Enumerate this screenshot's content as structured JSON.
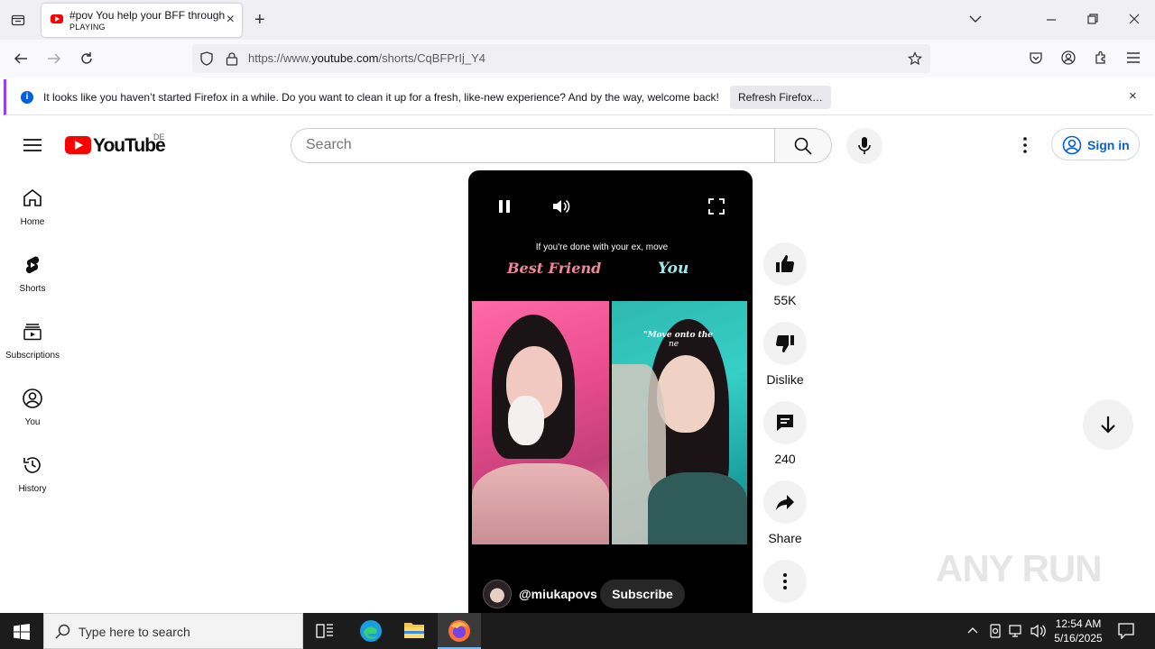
{
  "browser": {
    "tab": {
      "title": "#pov You help your BFF through",
      "status": "PLAYING",
      "close": "×"
    },
    "new_tab": "+",
    "url_prefix": "https://www.",
    "url_domain": "youtube.com",
    "url_path": "/shorts/CqBFPrIj_Y4",
    "notification": {
      "message": "It looks like you haven’t started Firefox in a while. Do you want to clean it up for a fresh, like-new experience? And by the way, welcome back!",
      "button": "Refresh Firefox…",
      "info_glyph": "i",
      "close": "×"
    }
  },
  "youtube": {
    "logo_text": "YouTube",
    "country": "DE",
    "search_placeholder": "Search",
    "signin_label": "Sign in",
    "sidebar": [
      {
        "label": "Home",
        "icon": "home-icon"
      },
      {
        "label": "Shorts",
        "icon": "shorts-icon"
      },
      {
        "label": "Subscriptions",
        "icon": "subscriptions-icon"
      },
      {
        "label": "You",
        "icon": "you-icon"
      },
      {
        "label": "History",
        "icon": "history-icon"
      }
    ],
    "video": {
      "caption_line1": "If you're done with your ex, move",
      "caption_left": "Best Friend",
      "caption_right": "You",
      "overlay_text": "\"Move onto the",
      "overlay_text2": "ne",
      "channel": "@miukapovs",
      "subscribe_label": "Subscribe"
    },
    "actions": {
      "like_count": "55K",
      "dislike_label": "Dislike",
      "comment_count": "240",
      "share_label": "Share"
    }
  },
  "watermark": "ANY RUN",
  "taskbar": {
    "search_placeholder": "Type here to search",
    "time": "12:54 AM",
    "date": "5/16/2025"
  }
}
